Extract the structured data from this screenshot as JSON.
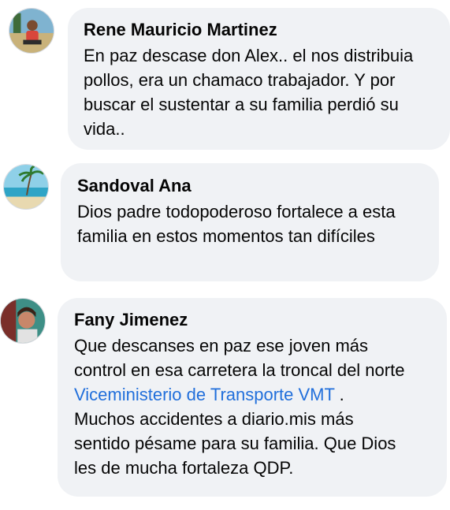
{
  "comments": [
    {
      "author": "Rene Mauricio Martinez",
      "lines": [
        "En paz descase don Alex..  el nos distribuia",
        "pollos, era un chamaco trabajador. Y por",
        "buscar el sustentar a su familia perdió su",
        "vida.."
      ]
    },
    {
      "author": "Sandoval Ana",
      "lines": [
        "Dios padre todopoderoso fortalece a esta",
        "familia  en estos momentos tan difíciles"
      ]
    },
    {
      "author": "Fany Jimenez",
      "line1": "Que descanses en paz ese joven  más",
      "line2": "control en esa carretera la troncal del norte",
      "mention": "Viceministerio de Transporte VMT",
      "mention_suffix": " .",
      "line4": "Muchos accidentes a diario.mis más",
      "line5": "sentido pésame para su familia. Que Dios",
      "line6": "les de mucha fortaleza QDP."
    }
  ]
}
